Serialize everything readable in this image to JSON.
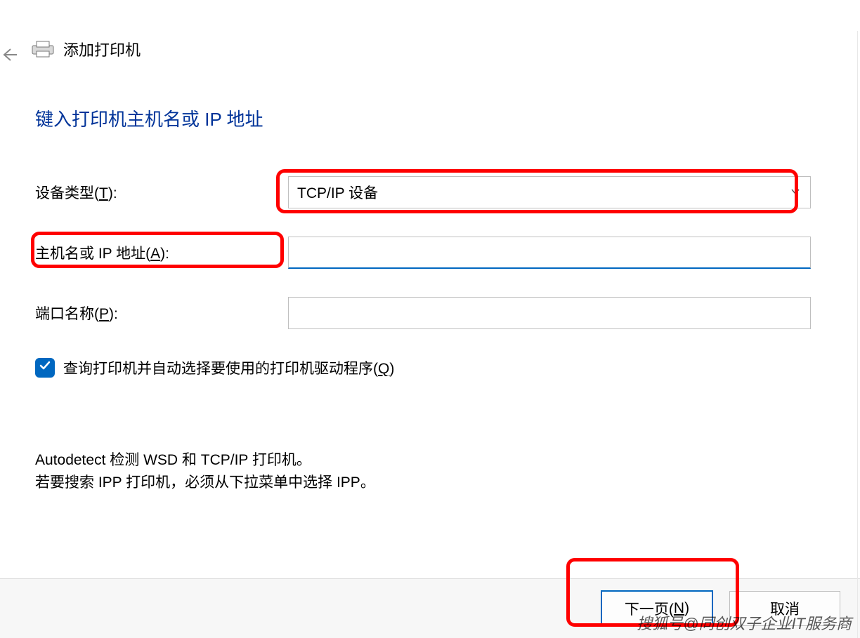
{
  "header": {
    "wizard_title": "添加打印机"
  },
  "page": {
    "heading": "键入打印机主机名或 IP 地址"
  },
  "form": {
    "device_type": {
      "label_pre": "设备类型(",
      "label_key": "T",
      "label_post": "):",
      "value": "TCP/IP 设备"
    },
    "host_address": {
      "label_pre": "主机名或 IP 地址(",
      "label_key": "A",
      "label_post": "):",
      "value": ""
    },
    "port_name": {
      "label_pre": "端口名称(",
      "label_key": "P",
      "label_post": "):",
      "value": ""
    },
    "query_driver": {
      "checked": true,
      "label_pre": "查询打印机并自动选择要使用的打印机驱动程序(",
      "label_key": "Q",
      "label_post": ")"
    }
  },
  "note": {
    "line1": "Autodetect 检测 WSD 和 TCP/IP 打印机。",
    "line2": "若要搜索 IPP 打印机，必须从下拉菜单中选择 IPP。"
  },
  "footer": {
    "next_pre": "下一页(",
    "next_key": "N",
    "next_post": ")",
    "cancel": "取消"
  },
  "watermark": "搜狐号@同创双子企业IT服务商"
}
